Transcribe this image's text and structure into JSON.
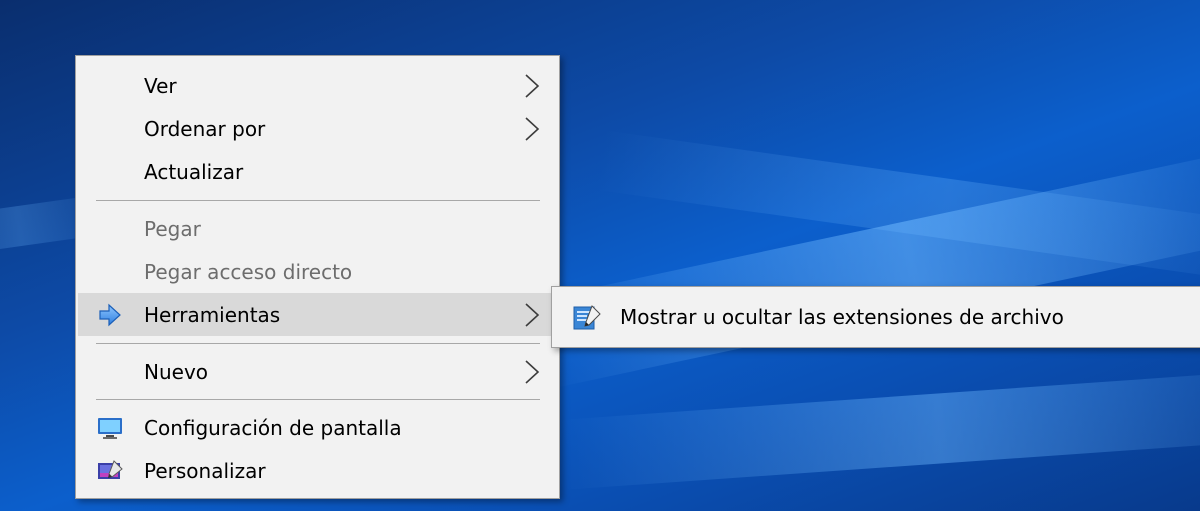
{
  "context_menu": {
    "items": [
      {
        "label": "Ver",
        "icon": "",
        "has_submenu": true,
        "disabled": false
      },
      {
        "label": "Ordenar por",
        "icon": "",
        "has_submenu": true,
        "disabled": false
      },
      {
        "label": "Actualizar",
        "icon": "",
        "has_submenu": false,
        "disabled": false
      },
      {
        "label": "Pegar",
        "icon": "",
        "has_submenu": false,
        "disabled": true
      },
      {
        "label": "Pegar acceso directo",
        "icon": "",
        "has_submenu": false,
        "disabled": true
      },
      {
        "label": "Herramientas",
        "icon": "arrow-right-icon",
        "has_submenu": true,
        "disabled": false,
        "highlighted": true
      },
      {
        "label": "Nuevo",
        "icon": "",
        "has_submenu": true,
        "disabled": false
      },
      {
        "label": "Configuración de pantalla",
        "icon": "display-settings-icon",
        "has_submenu": false,
        "disabled": false
      },
      {
        "label": "Personalizar",
        "icon": "personalize-icon",
        "has_submenu": false,
        "disabled": false
      }
    ]
  },
  "submenu": {
    "items": [
      {
        "label": "Mostrar u ocultar las extensiones de archivo",
        "icon": "file-extension-icon"
      }
    ]
  },
  "colors": {
    "menu_bg": "#f2f2f2",
    "highlight_bg": "#d9d9d9",
    "disabled_text": "#6d6d6d",
    "desktop_blue": "#0c5fcc"
  }
}
